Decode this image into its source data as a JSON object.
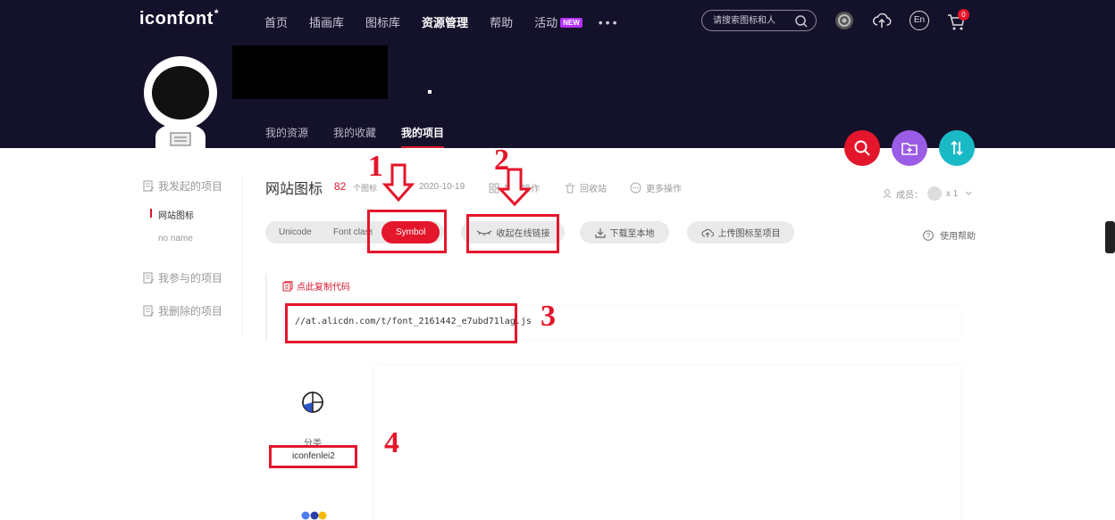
{
  "header": {
    "logo": "iconfont",
    "logo_mark": "*",
    "nav": [
      "首页",
      "插画库",
      "图标库",
      "资源管理",
      "帮助",
      "活动"
    ],
    "nav_active": "资源管理",
    "new_badge": "NEW",
    "more": "•••",
    "search_placeholder": "请搜索图标和人",
    "lang": "En",
    "cart_count": "0"
  },
  "profile": {
    "tabs": [
      "我的资源",
      "我的收藏",
      "我的项目"
    ],
    "active_tab": "我的项目"
  },
  "sidebar": {
    "started": "我发起的项目",
    "projects": [
      "网站图标",
      "no name"
    ],
    "joined": "我参与的项目",
    "deleted": "我删除的项目"
  },
  "project": {
    "title": "网站图标",
    "count": "82",
    "count_label": "个图标",
    "date": "2020-10-19",
    "batch": "批量操作",
    "recycle": "回收站",
    "more_ops": "更多操作",
    "members_label": "成员：",
    "members_count": "x 1"
  },
  "toolbar": {
    "tabs": [
      "Unicode",
      "Font class",
      "Symbol"
    ],
    "active_tab": "Symbol",
    "collapse_link": "收起在线链接",
    "download": "下载至本地",
    "upload": "上传图标至项目",
    "help": "使用帮助"
  },
  "code": {
    "copy": "点此复制代码",
    "url": "//at.alicdn.com/t/font_2161442_e7ubd71lag.js"
  },
  "category": {
    "label": "分类",
    "name": "iconfenlei2"
  },
  "annotations": [
    "1",
    "2",
    "3",
    "4"
  ],
  "colors": {
    "header_bg": "#14112b",
    "accent_red": "#e4162b",
    "fab_purple": "#9b5ce6",
    "fab_teal": "#1ab9c6"
  }
}
